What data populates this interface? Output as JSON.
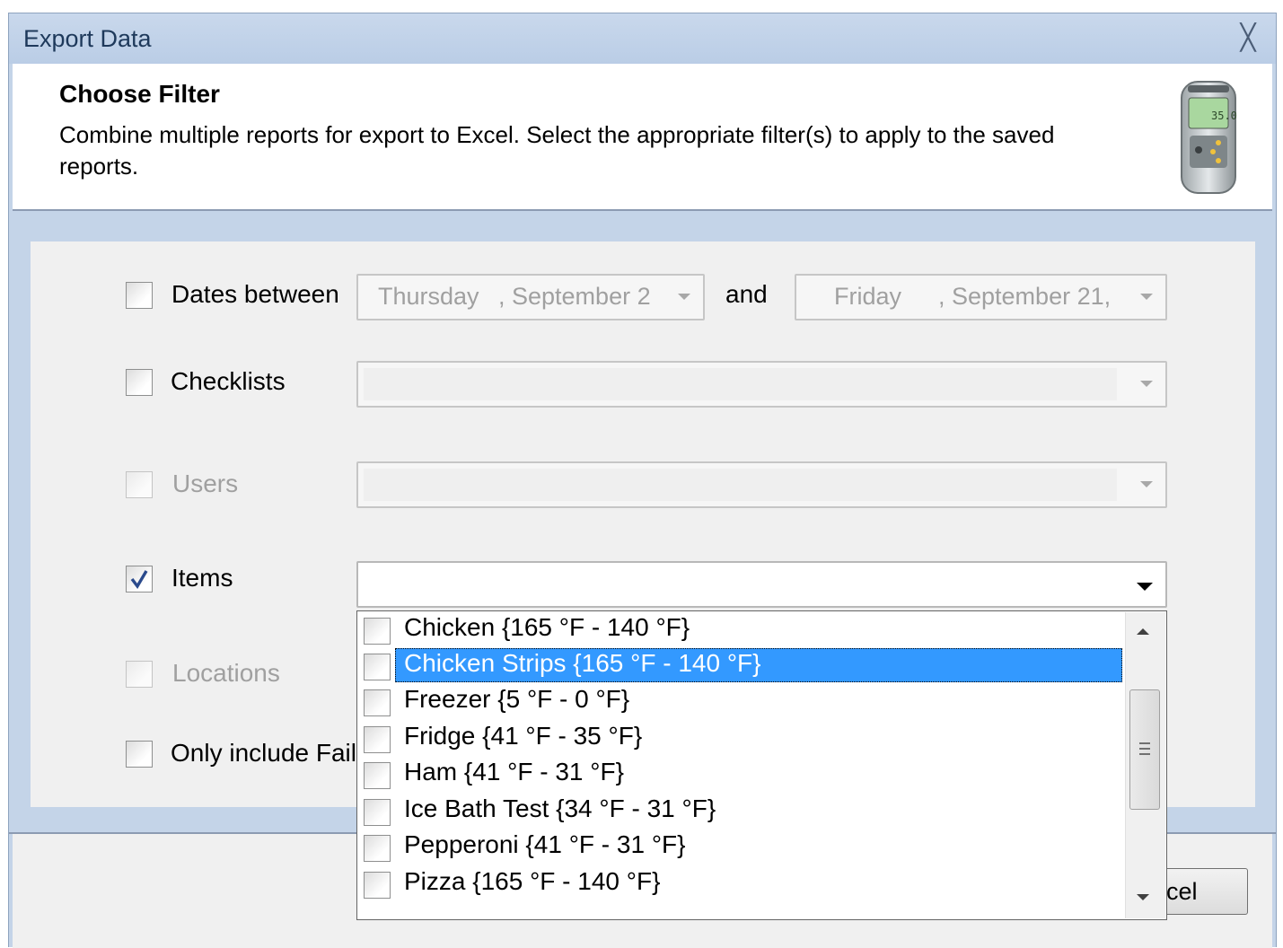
{
  "window": {
    "title": "Export Data",
    "close_glyph": "╳"
  },
  "header": {
    "title": "Choose Filter",
    "description": "Combine multiple reports for export to Excel. Select the appropriate filter(s) to apply to the saved reports."
  },
  "filters": {
    "dates": {
      "label": "Dates between",
      "checked": false,
      "from_day": "Thursday",
      "from_date": ", September 2",
      "and_label": "and",
      "to_day": "Friday",
      "to_date": ", September 21,"
    },
    "checklists": {
      "label": "Checklists",
      "checked": false
    },
    "users": {
      "label": "Users",
      "checked": false,
      "enabled": false
    },
    "items": {
      "label": "Items",
      "checked": true
    },
    "locations": {
      "label": "Locations",
      "checked": false,
      "enabled": false
    },
    "failed": {
      "label": "Only include Fail",
      "checked": false
    }
  },
  "items_dropdown": {
    "selected_index": 1,
    "options": [
      "Chicken {165 °F - 140 °F}",
      "Chicken Strips {165 °F - 140 °F}",
      "Freezer {5 °F - 0 °F}",
      "Fridge {41 °F - 35 °F}",
      "Ham {41 °F - 31 °F}",
      "Ice Bath Test {34 °F - 31 °F}",
      "Pepperoni {41 °F - 31 °F}",
      "Pizza {165 °F - 140 °F}"
    ]
  },
  "buttons": {
    "cancel_visible": "cel"
  },
  "icons": {
    "device": "thermometer-device-icon"
  },
  "colors": {
    "selection": "#3399ff",
    "titlebar": "#c4d4e8"
  }
}
